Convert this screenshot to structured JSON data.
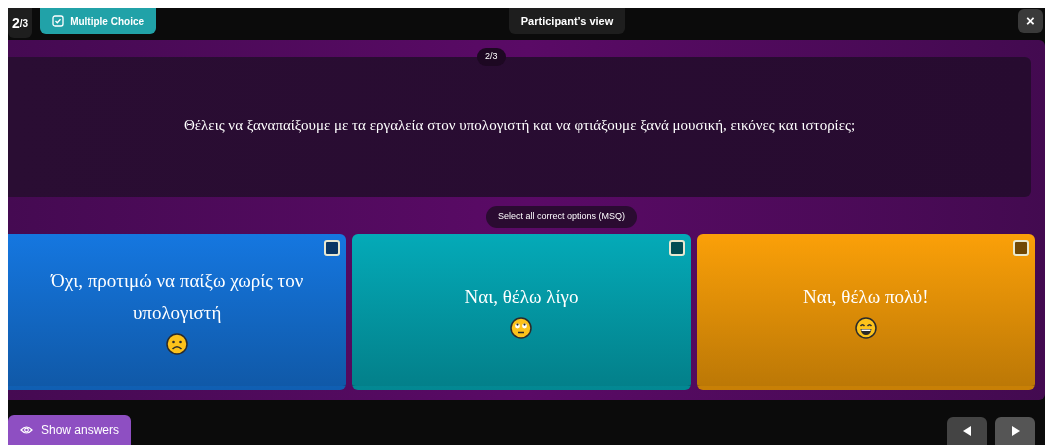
{
  "top_bar": {
    "counter": {
      "current": "2",
      "total": "/3"
    },
    "question_type": "Multiple Choice",
    "view_label": "Participant’s view",
    "close": "×"
  },
  "question": {
    "progress": "2/3",
    "text": "Θέλεις να ξαναπαίξουμε με τα εργαλεία στον υπολογιστή και να φτιάξουμε ξανά μουσική, εικόνες και ιστορίες;"
  },
  "instruction": "Select all correct options (MSQ)",
  "options": [
    {
      "text": "Όχι, προτιμώ να παίξω χωρίς τον υπολογιστή",
      "color": "#1577e0",
      "checked": false
    },
    {
      "text": "Ναι, θέλω λίγο",
      "color": "#04aab8",
      "checked": false
    },
    {
      "text": "Ναι, θέλω πολύ!",
      "color": "#fba008",
      "checked": false
    }
  ],
  "footer": {
    "show_answers": "Show answers"
  }
}
